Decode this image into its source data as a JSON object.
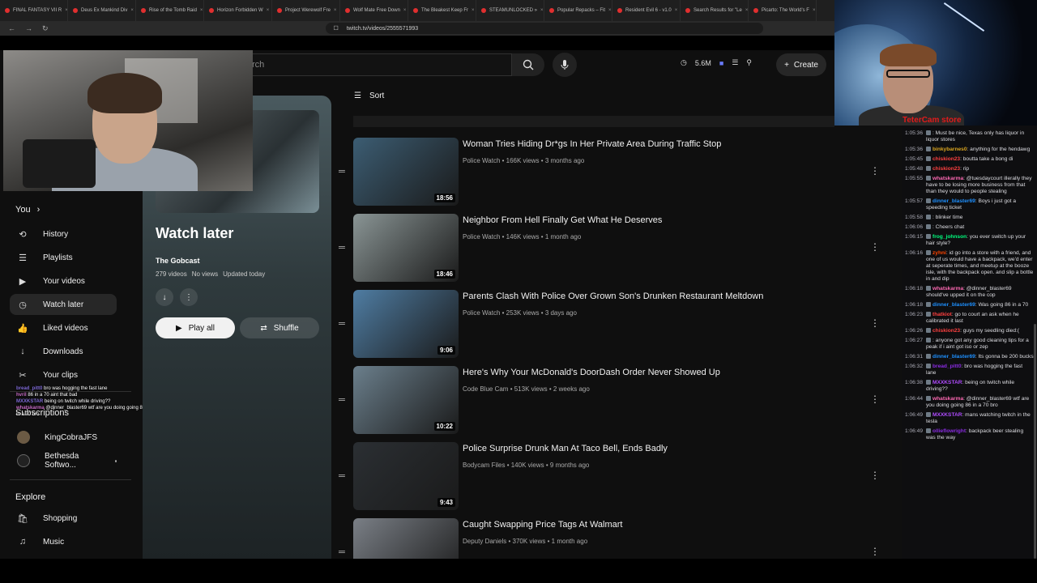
{
  "browser": {
    "tabs": [
      "FINAL FANTASY VII R",
      "Deus Ex Mankind Div",
      "Rise of the Tomb Raid",
      "Horizon Forbidden W",
      "Project Werewolf Fre",
      "Wolf Mate Free Down",
      "The Bleakest Keep Fr",
      "STEAMUNLOCKED » ",
      "Popular Repacks – Fit",
      "Resident Evil 6 - v1.0",
      "Search Results for \"Le",
      "Picarto: The World's F"
    ],
    "url": "twitch.tv/videos/2555571993"
  },
  "topbar": {
    "search_placeholder": "rch",
    "badge_count": "5.6M",
    "create_label": "Create"
  },
  "sidebar": {
    "you_label": "You",
    "items": [
      {
        "label": "History",
        "icon": "history-icon"
      },
      {
        "label": "Playlists",
        "icon": "playlists-icon"
      },
      {
        "label": "Your videos",
        "icon": "your-videos-icon"
      },
      {
        "label": "Watch later",
        "icon": "clock-icon"
      },
      {
        "label": "Liked videos",
        "icon": "thumbs-up-icon"
      },
      {
        "label": "Downloads",
        "icon": "download-icon"
      },
      {
        "label": "Your clips",
        "icon": "scissors-icon"
      }
    ],
    "subscriptions_label": "Subscriptions",
    "subscriptions": [
      "KingCobraJFS",
      "Bethesda Softwo..."
    ],
    "explore_label": "Explore",
    "explore": [
      {
        "label": "Shopping",
        "icon": "shopping-bag-icon"
      },
      {
        "label": "Music",
        "icon": "music-note-icon"
      }
    ]
  },
  "overlay_chat": [
    {
      "user": "bread_pitt0",
      "text": "bro was hogging the fast lane"
    },
    {
      "user": "hvril",
      "text": "86 in a 70 aint that bad"
    },
    {
      "user": "MXXKSTAR",
      "text": "being on twitch while driving??"
    },
    {
      "user": "whatskarma",
      "text": "@dinner_blaster69 wtf are you doing going 86 in a 70 bro"
    }
  ],
  "playlist": {
    "title": "Watch later",
    "owner": "The Gobcast",
    "videos": "279 videos",
    "views": "No views",
    "updated": "Updated today",
    "play_all": "Play all",
    "shuffle": "Shuffle"
  },
  "sort_label": "Sort",
  "videos": [
    {
      "title": "Woman Tries Hiding Dr*gs In Her Private Area During Traffic Stop",
      "channel": "Police Watch",
      "views": "166K views",
      "age": "3 months ago",
      "duration": "18:56",
      "thumb_color": "#3c5d73"
    },
    {
      "title": "Neighbor From Hell Finally Get What He Deserves",
      "channel": "Police Watch",
      "views": "146K views",
      "age": "1 month ago",
      "duration": "18:46",
      "thumb_color": "#8a9595"
    },
    {
      "title": "Parents Clash With Police Over Grown Son's Drunken Restaurant Meltdown",
      "channel": "Police Watch",
      "views": "253K views",
      "age": "3 days ago",
      "duration": "9:06",
      "thumb_color": "#4f7da3"
    },
    {
      "title": "Here's Why Your McDonald's DoorDash Order Never Showed Up",
      "channel": "Code Blue Cam",
      "views": "513K views",
      "age": "2 weeks ago",
      "duration": "10:22",
      "thumb_color": "#6b7f8c"
    },
    {
      "title": "Police Surprise Drunk Man At Taco Bell, Ends Badly",
      "channel": "Bodycam Files",
      "views": "140K views",
      "age": "9 months ago",
      "duration": "9:43",
      "thumb_color": "#2b2f33"
    },
    {
      "title": "Caught Swapping Price Tags At Walmart",
      "channel": "Deputy Daniels",
      "views": "370K views",
      "age": "1 month ago",
      "duration": "",
      "thumb_color": "#7a7f86"
    }
  ],
  "cam_label": "TeterCam store",
  "chat": [
    {
      "ts": "1:05:36",
      "user": "",
      "color": "#9147ff",
      "text": ": Must be nice, Texas only has liquor in liquor stores"
    },
    {
      "ts": "1:05:36",
      "user": "binkybarnes0",
      "color": "#daa520",
      "text": ": anything for the hendawg"
    },
    {
      "ts": "1:05:45",
      "user": "chiskion23",
      "color": "#ff4040",
      "text": ": boutta take a bong di"
    },
    {
      "ts": "1:05:48",
      "user": "chiskion23",
      "color": "#ff4040",
      "text": ": rip"
    },
    {
      "ts": "1:05:55",
      "user": "whatskarma",
      "color": "#ff69b4",
      "text": ": @tuesdaycourt illerally they have to be losing more business from that than they would to people stealing"
    },
    {
      "ts": "1:05:57",
      "user": "dinner_blaster69",
      "color": "#1e90ff",
      "text": ": Boys i just got a speeding ticket"
    },
    {
      "ts": "1:05:58",
      "user": "",
      "color": "#9147ff",
      "text": ": blinker time"
    },
    {
      "ts": "1:06:06",
      "user": "",
      "color": "#9147ff",
      "text": ": Cheers chat"
    },
    {
      "ts": "1:06:15",
      "user": "frog_johnson",
      "color": "#00ff7f",
      "text": ": you ever switch up your hair style?"
    },
    {
      "ts": "1:06:16",
      "user": "zyhni",
      "color": "#ff4500",
      "text": ": id go into a store with a friend, and one of us would have a backpack, we'd enter at seperate times, and meetup at the booze isle, with the backpack open. and slip a bottle in and dip"
    },
    {
      "ts": "1:06:18",
      "user": "whatskarma",
      "color": "#ff69b4",
      "text": ": @dinner_blaster69 should've upped it on the cop"
    },
    {
      "ts": "1:06:18",
      "user": "dinner_blaster69",
      "color": "#1e90ff",
      "text": ": Was going 86 in a 70"
    },
    {
      "ts": "1:06:23",
      "user": "thatkiot",
      "color": "#ff4040",
      "text": ": go to court an ask when he calibrated it last"
    },
    {
      "ts": "1:06:26",
      "user": "chiskion23",
      "color": "#ff4040",
      "text": ": guys my seedling died:("
    },
    {
      "ts": "1:06:27",
      "user": "",
      "color": "#9147ff",
      "text": ": anyone got any good cleaning tips for a peak if i aint got iso or zep"
    },
    {
      "ts": "1:06:31",
      "user": "dinner_blaster69",
      "color": "#1e90ff",
      "text": ": Its gonna be 200 bucks"
    },
    {
      "ts": "1:06:32",
      "user": "bread_pitt0",
      "color": "#8a2be2",
      "text": ": bro was hogging the fast lane"
    },
    {
      "ts": "1:06:38",
      "user": "MXXKSTAR",
      "color": "#b04cff",
      "text": ": being on twitch while driving??"
    },
    {
      "ts": "1:06:44",
      "user": "whatskarma",
      "color": "#ff69b4",
      "text": ": @dinner_blaster69 wtf are you doing going 86 in a 70 bro"
    },
    {
      "ts": "1:06:49",
      "user": "MXXKSTAR",
      "color": "#b04cff",
      "text": ": mans watching twitch in the tesla"
    },
    {
      "ts": "1:06:49",
      "user": "ollieflowright",
      "color": "#8a2be2",
      "text": ": backpack beer stealing was the way"
    }
  ]
}
